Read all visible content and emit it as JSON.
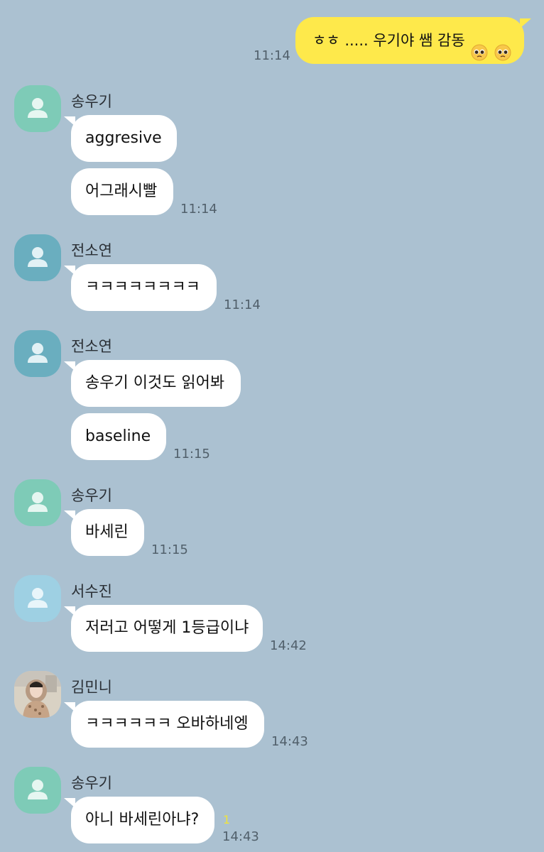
{
  "my_message": {
    "text": "ㅎㅎ ..... 우기야 쌤 감동",
    "time": "11:14",
    "emoji": "pleading-face-icon"
  },
  "groups": [
    {
      "sender": "송우기",
      "messages": [
        "aggresive",
        "어그래시빨"
      ],
      "time": "11:14",
      "avatar_color": "#7ecbb7"
    },
    {
      "sender": "전소연",
      "messages": [
        "ㅋㅋㅋㅋㅋㅋㅋㅋ"
      ],
      "time": "11:14",
      "avatar_color": "#6aaebf"
    },
    {
      "sender": "전소연",
      "messages": [
        "송우기 이것도 읽어봐",
        "baseline"
      ],
      "time": "11:15",
      "avatar_color": "#6aaebf"
    },
    {
      "sender": "송우기",
      "messages": [
        "바세린"
      ],
      "time": "11:15",
      "avatar_color": "#7ecbb7"
    },
    {
      "sender": "서수진",
      "messages": [
        "저러고 어떻게 1등급이냐"
      ],
      "time": "14:42",
      "avatar_color": "#9ed0e3"
    },
    {
      "sender": "김민니",
      "messages": [
        "ㅋㅋㅋㅋㅋㅋ 오바하네엥"
      ],
      "time": "14:43",
      "avatar_color": "photo"
    },
    {
      "sender": "송우기",
      "messages": [
        "아니 바세린아냐?"
      ],
      "time": "14:43",
      "unread": "1",
      "avatar_color": "#7ecbb7"
    }
  ]
}
